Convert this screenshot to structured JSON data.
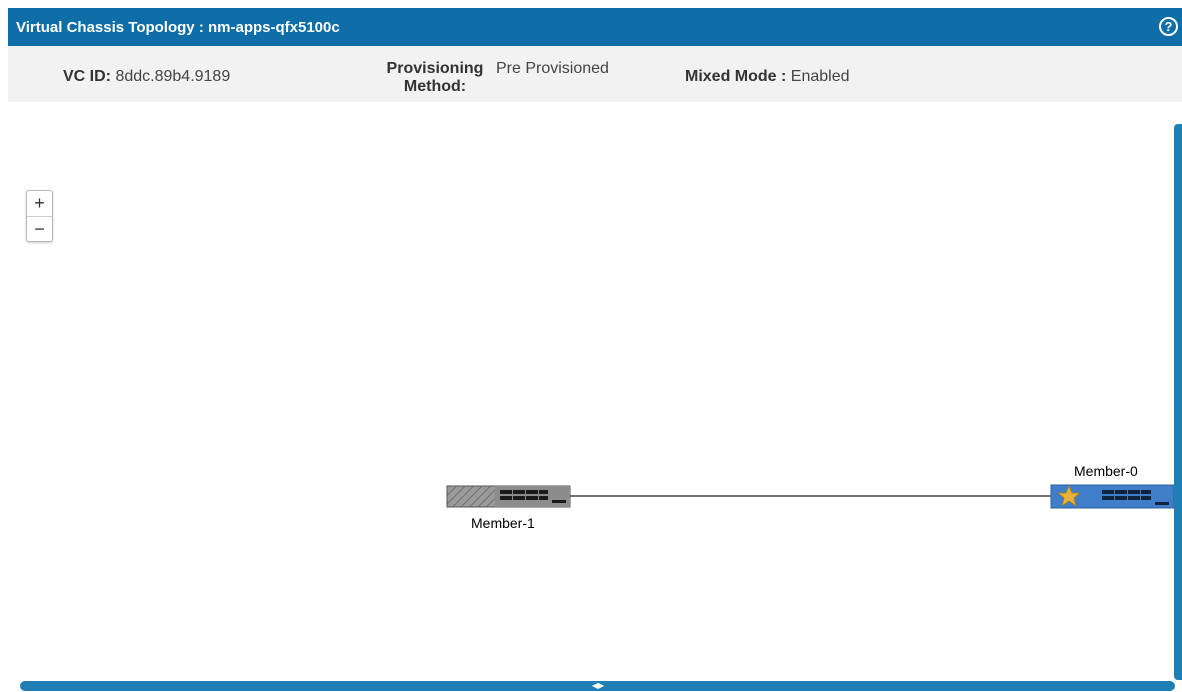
{
  "header": {
    "title": "Virtual Chassis Topology : nm-apps-qfx5100c",
    "help_glyph": "?"
  },
  "info": {
    "vc_id_label": "VC ID:",
    "vc_id_value": "8ddc.89b4.9189",
    "provisioning_label_line1": "Provisioning",
    "provisioning_label_line2": "Method:",
    "provisioning_value": "Pre Provisioned",
    "mixed_mode_label": "Mixed Mode :",
    "mixed_mode_value": "Enabled"
  },
  "zoom": {
    "in_label": "+",
    "out_label": "−"
  },
  "topology": {
    "members": [
      {
        "name": "Member-1",
        "role": "backup",
        "style": "hatched-gray"
      },
      {
        "name": "Member-0",
        "role": "master",
        "style": "blue-star"
      }
    ]
  },
  "colors": {
    "title_bar": "#0f6ea8",
    "info_bar": "#f2f2f2",
    "scrollbar": "#1f7fb5",
    "master_node": "#3f7fc9",
    "backup_node": "#8a8a8a",
    "star": "#e8b13b"
  },
  "icons": {
    "help": "help-circle-icon",
    "zoom_in": "plus-icon",
    "zoom_out": "minus-icon",
    "master": "star-icon"
  }
}
